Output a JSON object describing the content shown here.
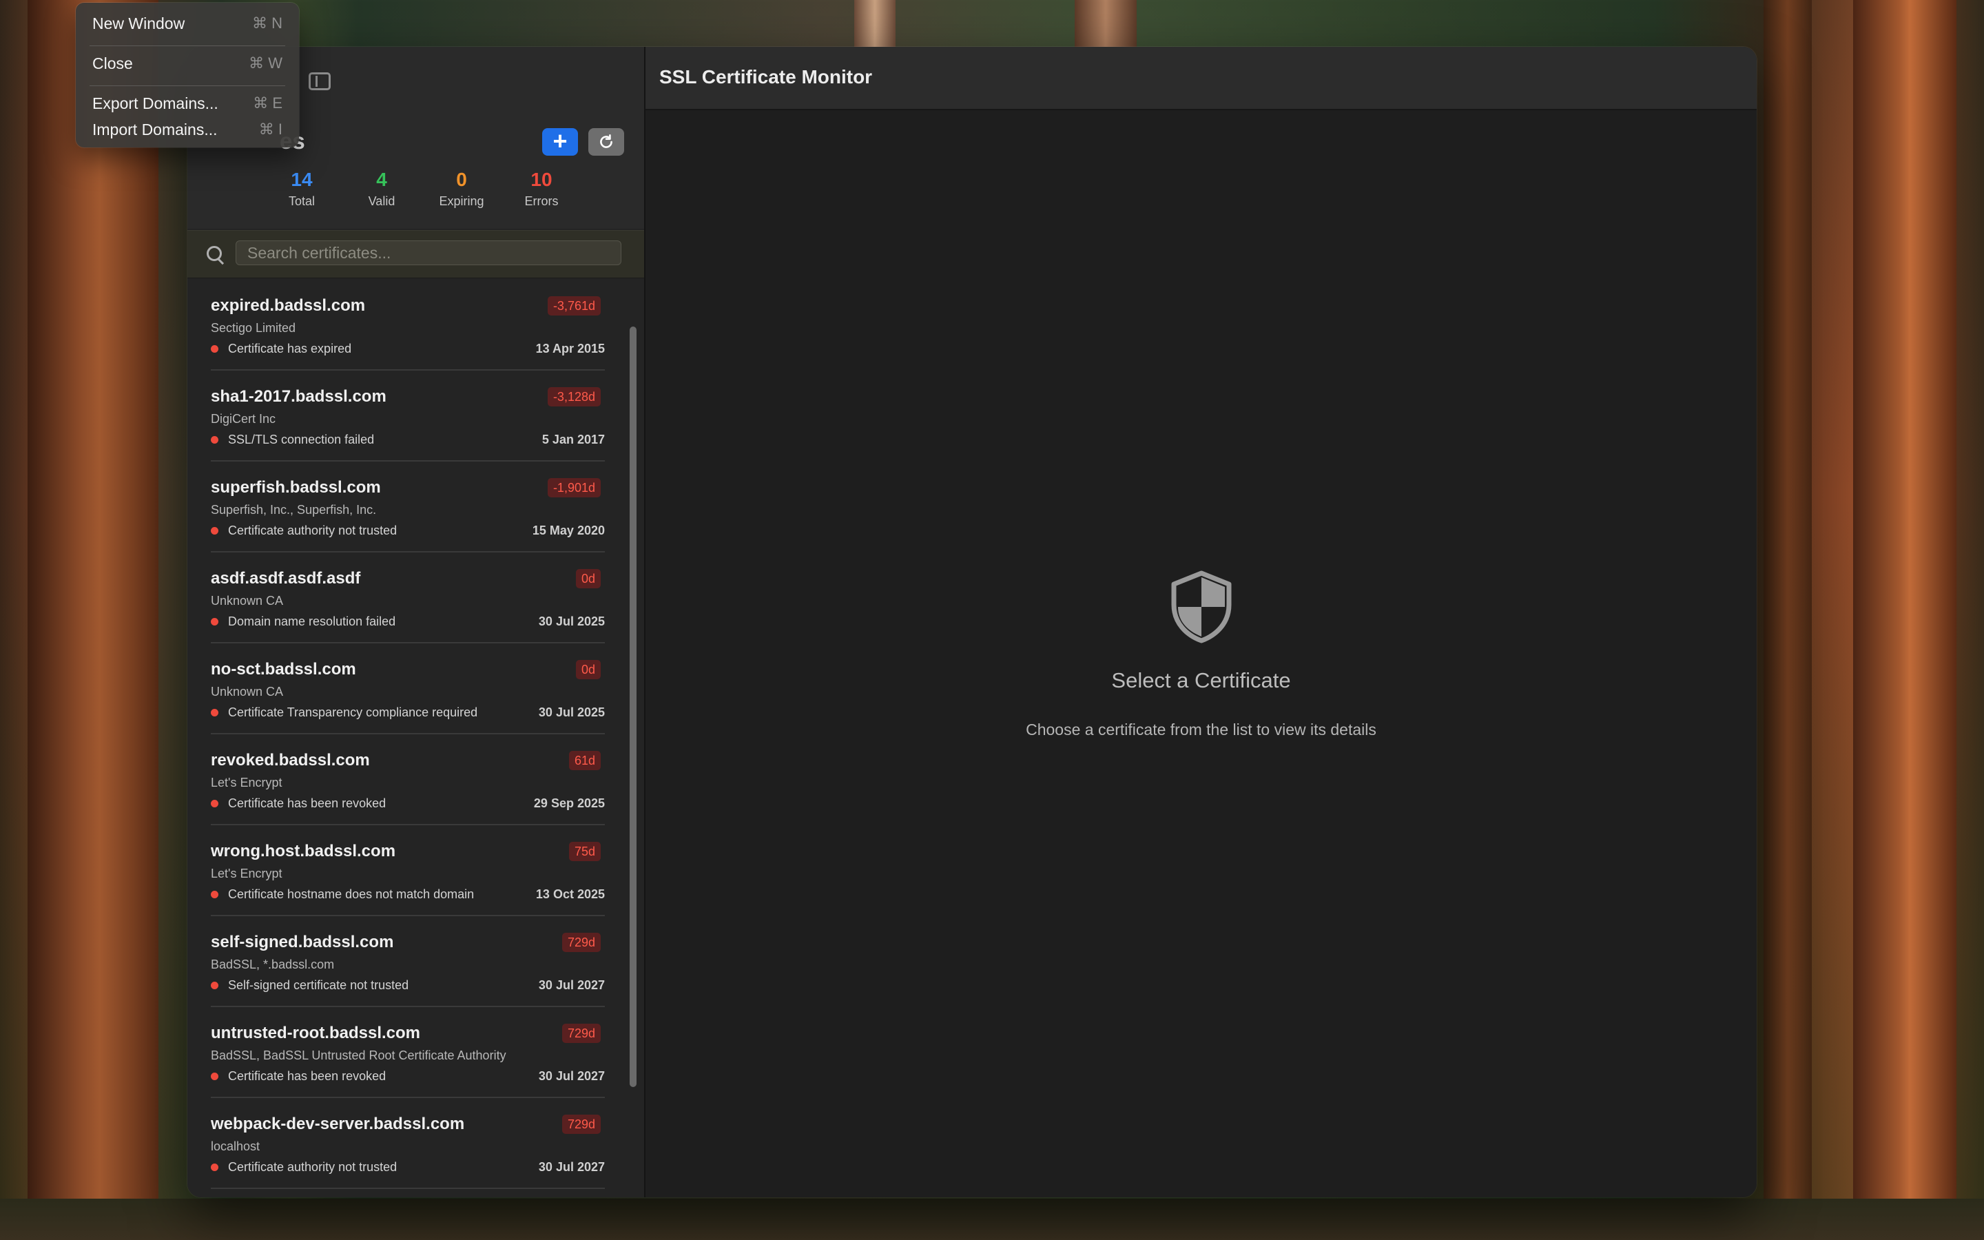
{
  "menu": {
    "items": [
      {
        "label": "New Window",
        "shortcut": "⌘ N"
      },
      {
        "label": "Close",
        "shortcut": "⌘ W"
      },
      {
        "label": "Export Domains...",
        "shortcut": "⌘ E"
      },
      {
        "label": "Import Domains...",
        "shortcut": "⌘ I"
      }
    ]
  },
  "sidebar": {
    "title": "Certificates",
    "title_visible": "es",
    "add_label": "+",
    "refresh_label": "↻",
    "stats": {
      "total": {
        "value": "14",
        "label": "Total"
      },
      "valid": {
        "value": "4",
        "label": "Valid"
      },
      "expiring": {
        "value": "0",
        "label": "Expiring"
      },
      "errors": {
        "value": "10",
        "label": "Errors"
      }
    },
    "search": {
      "placeholder": "Search certificates...",
      "value": ""
    }
  },
  "certificates": [
    {
      "domain": "expired.badssl.com",
      "issuer": "Sectigo Limited",
      "status": "Certificate has expired",
      "date": "13 Apr 2015",
      "days": "-3,761d"
    },
    {
      "domain": "sha1-2017.badssl.com",
      "issuer": "DigiCert Inc",
      "status": "SSL/TLS connection failed",
      "date": "5 Jan 2017",
      "days": "-3,128d"
    },
    {
      "domain": "superfish.badssl.com",
      "issuer": "Superfish, Inc., Superfish, Inc.",
      "status": "Certificate authority not trusted",
      "date": "15 May 2020",
      "days": "-1,901d"
    },
    {
      "domain": "asdf.asdf.asdf.asdf",
      "issuer": "Unknown CA",
      "status": "Domain name resolution failed",
      "date": "30 Jul 2025",
      "days": "0d"
    },
    {
      "domain": "no-sct.badssl.com",
      "issuer": "Unknown CA",
      "status": "Certificate Transparency compliance required",
      "date": "30 Jul 2025",
      "days": "0d"
    },
    {
      "domain": "revoked.badssl.com",
      "issuer": "Let's Encrypt",
      "status": "Certificate has been revoked",
      "date": "29 Sep 2025",
      "days": "61d"
    },
    {
      "domain": "wrong.host.badssl.com",
      "issuer": "Let's Encrypt",
      "status": "Certificate hostname does not match domain",
      "date": "13 Oct 2025",
      "days": "75d"
    },
    {
      "domain": "self-signed.badssl.com",
      "issuer": "BadSSL, *.badssl.com",
      "status": "Self-signed certificate not trusted",
      "date": "30 Jul 2027",
      "days": "729d"
    },
    {
      "domain": "untrusted-root.badssl.com",
      "issuer": "BadSSL, BadSSL Untrusted Root Certificate Authority",
      "status": "Certificate has been revoked",
      "date": "30 Jul 2027",
      "days": "729d"
    },
    {
      "domain": "webpack-dev-server.badssl.com",
      "issuer": "localhost",
      "status": "Certificate authority not trusted",
      "date": "30 Jul 2027",
      "days": "729d"
    }
  ],
  "detail": {
    "title": "SSL Certificate Monitor",
    "empty_title": "Select a Certificate",
    "empty_subtitle": "Choose a certificate from the list to view its details",
    "icon": "shield-icon"
  },
  "colors": {
    "accent": "#1f6fe8",
    "valid": "#36c25a",
    "expiring": "#f0922a",
    "error": "#ef4a3c"
  }
}
